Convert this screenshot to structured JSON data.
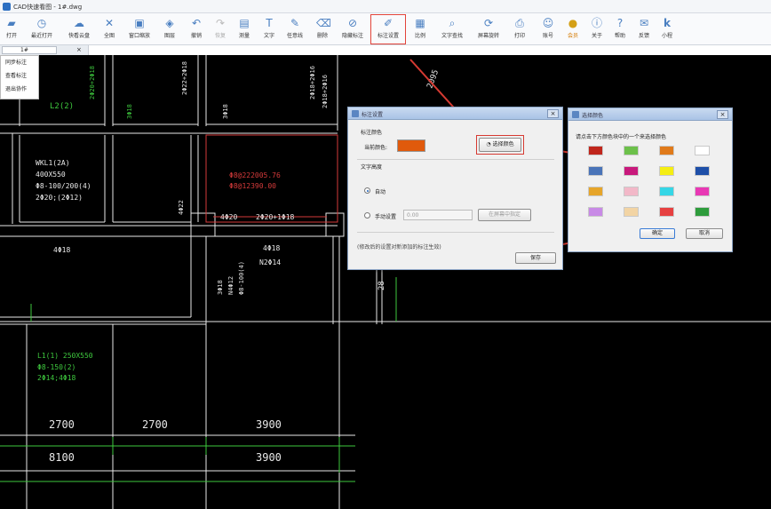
{
  "window": {
    "title": "CAD快速看图 - 1#.dwg"
  },
  "toolbar": {
    "items": [
      {
        "label": "打开",
        "icon": "folder-icon"
      },
      {
        "label": "最近打开",
        "icon": "clock-icon"
      },
      {
        "label": "快看云盘",
        "icon": "cloud-icon"
      },
      {
        "label": "全图",
        "icon": "fit-all-icon"
      },
      {
        "label": "窗口缩放",
        "icon": "window-zoom-icon"
      },
      {
        "label": "图层",
        "icon": "layers-icon"
      },
      {
        "label": "撤销",
        "icon": "undo-icon"
      },
      {
        "label": "恢复",
        "icon": "redo-icon"
      },
      {
        "label": "测量",
        "icon": "ruler-icon"
      },
      {
        "label": "文字",
        "icon": "text-icon"
      },
      {
        "label": "任意线",
        "icon": "pencil-icon"
      },
      {
        "label": "删除",
        "icon": "eraser-icon"
      },
      {
        "label": "隐藏标注",
        "icon": "hide-annotation-icon"
      },
      {
        "label": "标注设置",
        "icon": "annotation-settings-icon"
      },
      {
        "label": "比例",
        "icon": "scale-icon"
      },
      {
        "label": "文字查找",
        "icon": "text-search-icon"
      },
      {
        "label": "屏幕旋转",
        "icon": "rotate-icon"
      },
      {
        "label": "打印",
        "icon": "printer-icon"
      },
      {
        "label": "账号",
        "icon": "user-icon"
      },
      {
        "label": "会员",
        "icon": "vip-icon"
      },
      {
        "label": "关于",
        "icon": "info-icon"
      },
      {
        "label": "帮助",
        "icon": "help-icon"
      },
      {
        "label": "反馈",
        "icon": "feedback-icon"
      },
      {
        "label": "小程",
        "icon": "k-app-icon"
      }
    ]
  },
  "tab": {
    "label": "1#"
  },
  "side_menu": {
    "items": [
      "同步标注",
      "查看标注",
      "退出协作"
    ]
  },
  "drawing": {
    "texts": [
      "L2(2)",
      "2Φ20+2Φ18",
      "2Φ22+2Φ18",
      "2Φ18+2Φ16",
      "3Φ18",
      "3Φ18",
      "2Φ18+2Φ16",
      "2095",
      "WKL1(2A)",
      "400X550",
      "Φ8-100/200(4)",
      "2Φ20;(2Φ12)",
      "Φ8@222005.76",
      "Φ8@12390.00",
      "4Φ22",
      "4Φ20",
      "2Φ20+1Φ18",
      "4Φ18",
      "4Φ18",
      "N2Φ14",
      "3Φ18",
      "N4Φ12",
      "Φ8-100(4)",
      "28",
      "L1(1) 250X550",
      "Φ8-150(2)",
      "2Φ14;4Φ18",
      "2700",
      "2700",
      "3900",
      "8100",
      "3900"
    ]
  },
  "annotation_dialog": {
    "title": "标注设置",
    "color_section": "标注颜色",
    "current_color_label": "当前颜色:",
    "current_color": "#e05a0c",
    "select_color_button": "选择颜色",
    "text_height_section": "文字高度",
    "auto_label": "自动",
    "manual_label": "手动设置",
    "manual_value": "0.00",
    "screen_pick_button": "在屏幕中指定",
    "note": "(修改后的设置对新添加的标注生效)",
    "save_button": "保存"
  },
  "color_dialog": {
    "title": "选择颜色",
    "prompt": "请点击下方颜色块中的一个来选择颜色",
    "colors": [
      "#c0261c",
      "#6cc04a",
      "#e07a1a",
      "#ffffff",
      "#4a74b8",
      "#c8197c",
      "#f5ee12",
      "#1e4fa8",
      "#e6a52a",
      "#f2b8c8",
      "#35d6e6",
      "#e838b4",
      "#c88ae6",
      "#f2d4a4",
      "#e64040",
      "#2e9c3c"
    ],
    "ok_button": "确定",
    "cancel_button": "取消"
  },
  "colors": {
    "highlight_red": "#d63a32",
    "drawing_green": "#3ec93e",
    "drawing_red": "#d43a3a"
  }
}
